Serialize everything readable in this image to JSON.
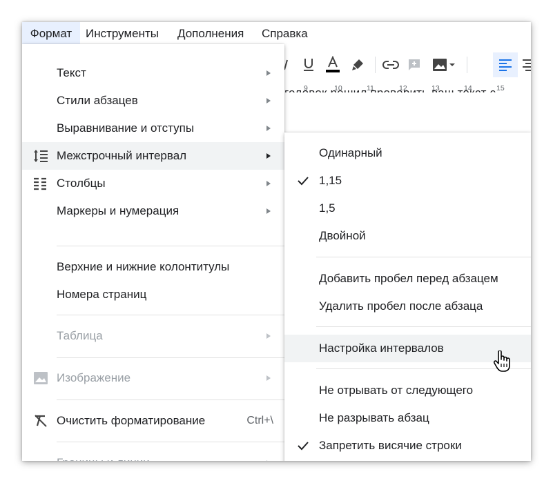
{
  "menubar": {
    "items": [
      {
        "label": "Формат",
        "active": true
      },
      {
        "label": "Инструменты"
      },
      {
        "label": "Дополнения"
      },
      {
        "label": "Справка"
      }
    ]
  },
  "toolbar": {
    "icons": [
      "underline-icon",
      "text-color-icon",
      "highlight-pen-icon",
      "link-icon",
      "add-comment-icon",
      "insert-image-icon",
      "align-left-icon",
      "align-center-icon",
      "align-right-icon"
    ],
    "accent": "#1a73e8",
    "ruler_ticks": [
      "9",
      "10",
      "11",
      "12",
      "13",
      "14",
      "15"
    ]
  },
  "document": {
    "text_fragment": "головок решил проверить ваш текст с"
  },
  "format_menu": {
    "items": [
      {
        "label": "Текст",
        "submenu": true
      },
      {
        "label": "Стили абзацев",
        "submenu": true
      },
      {
        "label": "Выравнивание и отступы",
        "submenu": true
      },
      {
        "label": "Межстрочный интервал",
        "submenu": true,
        "icon": "line-spacing-icon",
        "highlighted": true
      },
      {
        "label": "Столбцы",
        "submenu": true,
        "icon": "columns-icon"
      },
      {
        "label": "Маркеры и нумерация",
        "submenu": true
      },
      {
        "label": "Верхние и нижние колонтитулы"
      },
      {
        "label": "Номера страниц"
      },
      {
        "label": "Таблица",
        "submenu": true,
        "disabled": true
      },
      {
        "label": "Изображение",
        "submenu": true,
        "disabled": true,
        "icon": "image-icon"
      },
      {
        "label": "Очистить форматирование",
        "shortcut": "Ctrl+\\",
        "icon": "clear-formatting-icon"
      },
      {
        "label": "Границы и линии",
        "submenu": true,
        "disabled": true
      }
    ]
  },
  "spacing_menu": {
    "items": [
      {
        "label": "Одинарный"
      },
      {
        "label": "1,15",
        "checked": true
      },
      {
        "label": "1,5"
      },
      {
        "label": "Двойной"
      },
      {
        "label": "Добавить пробел перед абзацем"
      },
      {
        "label": "Удалить пробел после абзаца"
      },
      {
        "label": "Настройка интервалов",
        "hovered": true
      },
      {
        "label": "Не отрывать от следующего"
      },
      {
        "label": "Не разрывать абзац"
      },
      {
        "label": "Запретить висячие строки",
        "checked": true
      }
    ]
  },
  "colors": {
    "active_menu_bg": "#e8f0fe",
    "hover_bg": "#f1f3f4",
    "text": "#202124",
    "disabled": "#9aa0a6"
  }
}
